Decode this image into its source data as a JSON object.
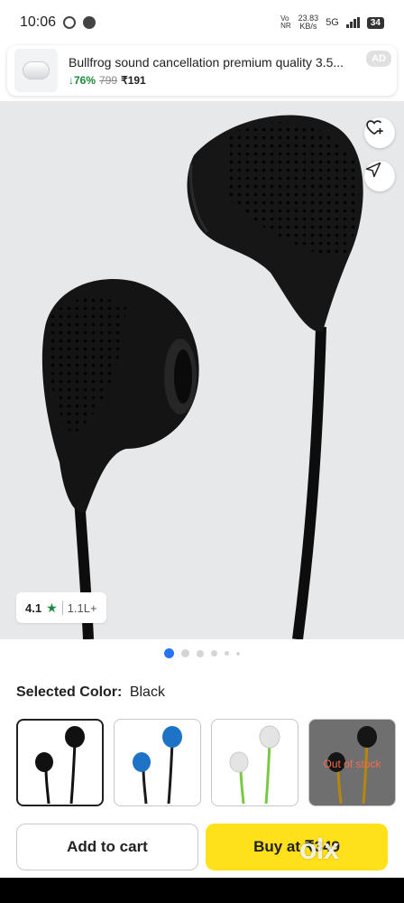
{
  "status_bar": {
    "time": "10:06",
    "speed_value": "23.83",
    "speed_unit": "KB/s",
    "volte_top": "Vo",
    "volte_bottom": "NR",
    "network": "5G",
    "battery": "34"
  },
  "ad": {
    "title": "Bullfrog sound cancellation premium quality 3.5...",
    "discount": "76%",
    "discount_arrow": "↓",
    "mrp": "799",
    "price": "₹191",
    "badge": "AD"
  },
  "product": {
    "rating": "4.1",
    "rating_star": "★",
    "rating_count": "1.1L+",
    "carousel_total": 6,
    "carousel_active": 0
  },
  "color_selector": {
    "label": "Selected Color:",
    "value": "Black",
    "options": [
      {
        "name": "black",
        "color": "#111111",
        "selected": true,
        "out_of_stock": false
      },
      {
        "name": "blue",
        "color": "#1f73c6",
        "selected": false,
        "out_of_stock": false
      },
      {
        "name": "white-green",
        "color": "#e9e9e9",
        "cable": "#7ac943",
        "selected": false,
        "out_of_stock": false
      },
      {
        "name": "black-gold",
        "color": "#151515",
        "cable": "#b8860b",
        "selected": false,
        "out_of_stock": true,
        "oos_text": "Out of stock"
      }
    ]
  },
  "actions": {
    "add_to_cart": "Add to cart",
    "buy_now": "Buy at ₹349"
  },
  "watermark": "olx",
  "colors": {
    "accent_green": "#1a8a3c",
    "buy_yellow": "#ffe11b",
    "dot_active": "#2874f0"
  },
  "icons": {
    "wishlist": "heart-plus-icon",
    "share": "share-icon"
  }
}
